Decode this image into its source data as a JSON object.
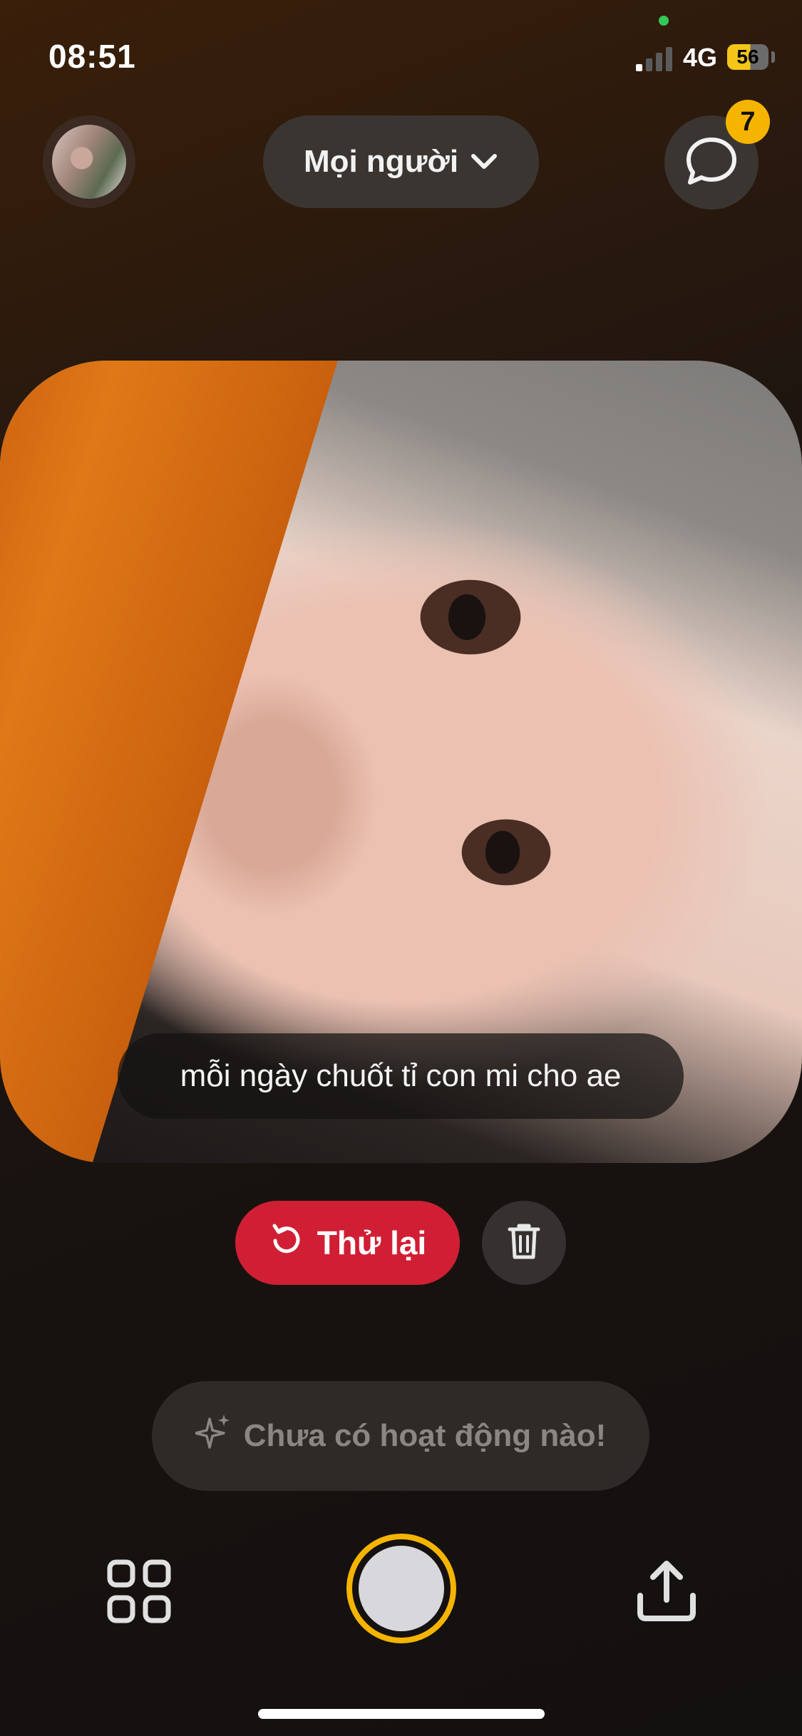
{
  "status": {
    "time": "08:51",
    "network": "4G",
    "battery": "56"
  },
  "header": {
    "audience_label": "Mọi người",
    "messages_badge": "7"
  },
  "photo": {
    "caption": "mỗi ngày chuốt tỉ con mi cho ae"
  },
  "actions": {
    "retry_label": "Thử lại"
  },
  "activity": {
    "text": "Chưa có hoạt động nào!"
  },
  "colors": {
    "accent_yellow": "#f5b400",
    "retry_red": "#d01f35",
    "pill_bg": "#3b3532"
  },
  "icons": [
    "chevron-down-icon",
    "chat-bubble-icon",
    "retry-icon",
    "trash-icon",
    "sparkles-icon",
    "grid-icon",
    "share-icon"
  ]
}
